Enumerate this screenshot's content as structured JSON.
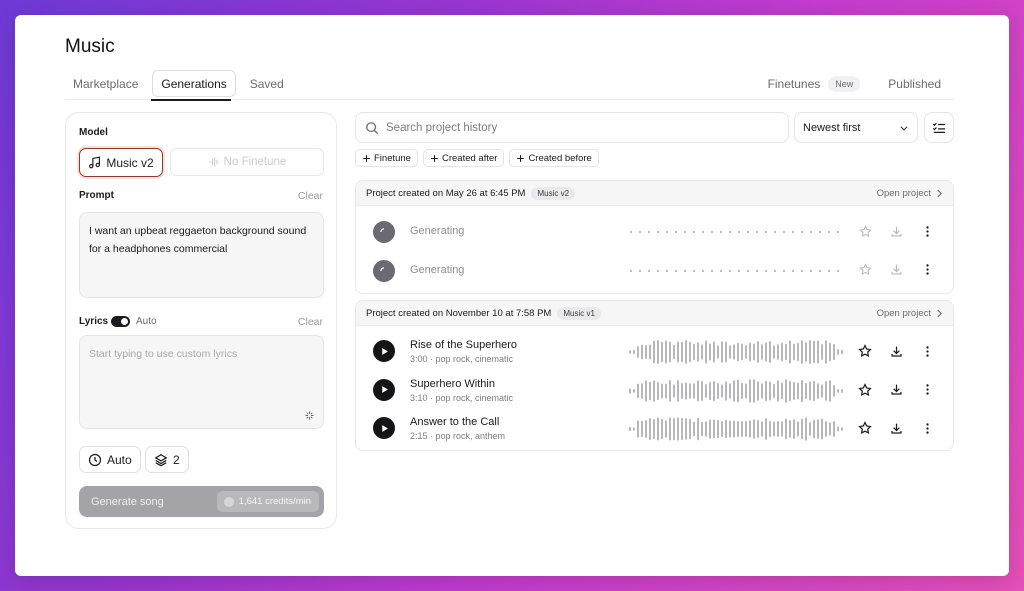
{
  "page_title": "Music",
  "tabs": [
    {
      "label": "Marketplace",
      "active": false
    },
    {
      "label": "Generations",
      "active": true
    },
    {
      "label": "Saved",
      "active": false
    }
  ],
  "tabs_right": {
    "finetunes": "Finetunes",
    "new_badge": "New",
    "published": "Published"
  },
  "left": {
    "model_label": "Model",
    "model_selected": "Music v2",
    "finetune_placeholder": "No Finetune",
    "prompt_label": "Prompt",
    "prompt_clear": "Clear",
    "prompt_value": "I want an upbeat reggaeton background sound for a headphones commercial",
    "lyrics_label": "Lyrics",
    "lyrics_toggle_label": "Auto",
    "lyrics_clear": "Clear",
    "lyrics_placeholder": "Start typing to use custom lyrics",
    "duration_label": "Auto",
    "variations": "2",
    "generate_label": "Generate song",
    "credits": "1,641 credits/min"
  },
  "search": {
    "placeholder": "Search project history"
  },
  "sort": {
    "selected": "Newest first"
  },
  "chips": [
    "Finetune",
    "Created after",
    "Created before"
  ],
  "projects": [
    {
      "header": "Project created on May 26 at 6:45 PM",
      "version": "Music v2",
      "open_label": "Open project",
      "tracks": [
        {
          "status": "Generating"
        },
        {
          "status": "Generating"
        }
      ]
    },
    {
      "header": "Project created on November 10 at 7:58 PM",
      "version": "Music v1",
      "open_label": "Open project",
      "tracks": [
        {
          "title": "Rise of the Superhero",
          "meta": "3:00 · pop rock, cinematic"
        },
        {
          "title": "Superhero Within",
          "meta": "3:10 · pop rock, cinematic"
        },
        {
          "title": "Answer to the Call",
          "meta": "2:15 · pop rock, anthem"
        }
      ]
    }
  ],
  "colors": {
    "accent_border": "#8a3a2c",
    "wave": "#b7b7bd",
    "dots": "#b5b5bb"
  },
  "icons": [
    "music-note-icon",
    "finetune-icon",
    "sparkle-icon",
    "clock-icon",
    "layers-icon",
    "search-icon",
    "chevron-down-icon",
    "filter-list-icon",
    "plus-icon",
    "chevron-right-icon",
    "play-icon",
    "spinner-icon",
    "star-icon",
    "download-icon",
    "more-vertical-icon"
  ]
}
